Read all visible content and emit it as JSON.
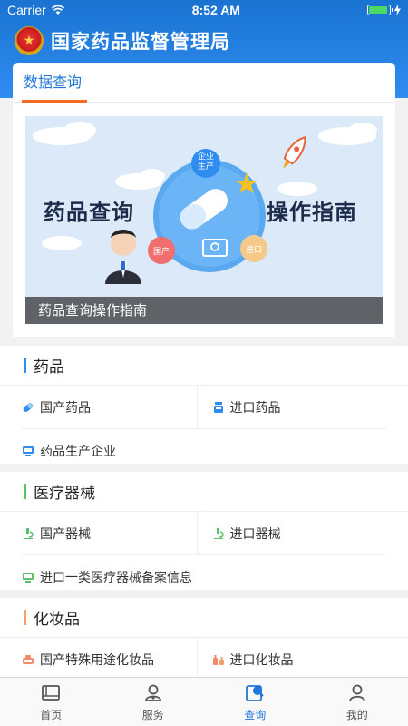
{
  "status_bar": {
    "carrier": "Carrier",
    "time": "8:52 AM",
    "battery_level": 0.9
  },
  "header": {
    "title": "国家药品监督管理局",
    "emblem_icon": "national-emblem-icon"
  },
  "query_card": {
    "tab_label": "数据查询",
    "banner": {
      "caption": "药品查询操作指南",
      "headline_left": "药品查询",
      "headline_right": "操作指南",
      "bubble_top": "企业\n生产",
      "bubble_left": "国产",
      "bubble_right": "进口"
    }
  },
  "sections": [
    {
      "title": "药品",
      "accent": "#2f8cf0",
      "rows": [
        [
          {
            "label": "国产药品",
            "icon": "capsule-icon"
          },
          {
            "label": "进口药品",
            "icon": "pill-box-icon"
          }
        ],
        [
          {
            "label": "药品生产企业",
            "icon": "factory-icon"
          }
        ]
      ]
    },
    {
      "title": "医疗器械",
      "accent": "#5cc06a",
      "rows": [
        [
          {
            "label": "国产器械",
            "icon": "microscope-icon"
          },
          {
            "label": "进口器械",
            "icon": "microscope-icon"
          }
        ],
        [
          {
            "label": "进口一类医疗器械备案信息",
            "icon": "monitor-icon"
          }
        ]
      ]
    },
    {
      "title": "化妆品",
      "accent": "#f0a06a",
      "rows": [
        [
          {
            "label": "国产特殊用途化妆品",
            "icon": "cosmetic-icon"
          },
          {
            "label": "进口化妆品",
            "icon": "bottles-icon"
          }
        ]
      ]
    }
  ],
  "tabbar": {
    "items": [
      {
        "label": "首页",
        "icon": "book-icon",
        "active": false
      },
      {
        "label": "服务",
        "icon": "service-icon",
        "active": false
      },
      {
        "label": "查询",
        "icon": "query-icon",
        "active": true
      },
      {
        "label": "我的",
        "icon": "user-icon",
        "active": false
      }
    ]
  }
}
